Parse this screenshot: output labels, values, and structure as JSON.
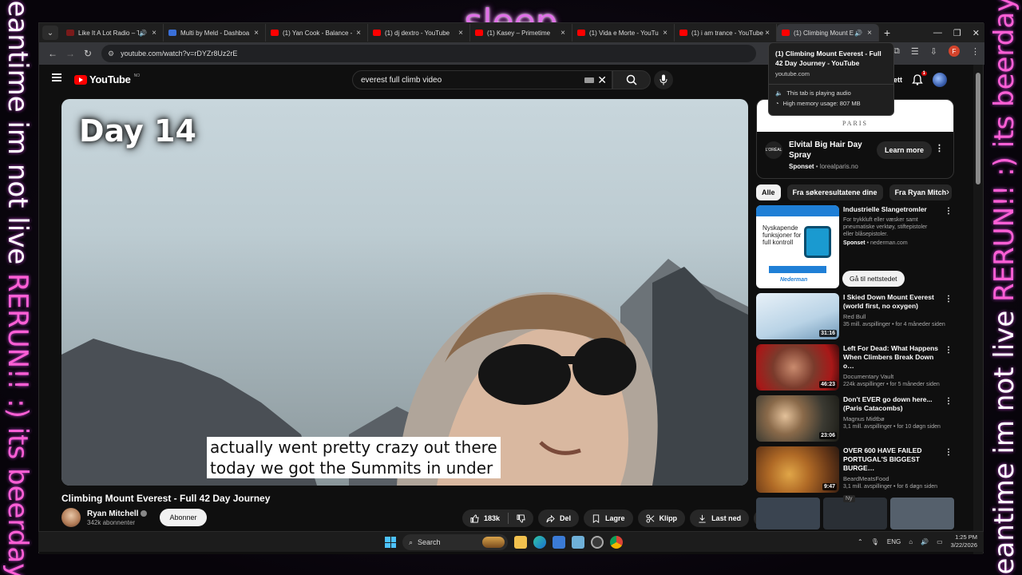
{
  "overlay": {
    "title": "sleep",
    "left_text_a": "meantime im not live ",
    "left_text_b": "RERUN!! :) its beerday!!",
    "right_text_a": "meantime im not live ",
    "right_text_b": "RERUN!! :) its beerday!!"
  },
  "tabs": [
    {
      "label": "Like It A Lot Radio – T",
      "favicon": "dark"
    },
    {
      "label": "Multi by Meld - Dashboa",
      "favicon": "blue"
    },
    {
      "label": "(1) Yan Cook - Balance - Y",
      "favicon": "red"
    },
    {
      "label": "(1) dj dextro - YouTube",
      "favicon": "red"
    },
    {
      "label": "(1) Kasey – Primetime",
      "favicon": "red"
    },
    {
      "label": "(1) Vida e Morte - YouTu",
      "favicon": "red"
    },
    {
      "label": "(1) i am trance - YouTube",
      "favicon": "red"
    },
    {
      "label": "(1) Climbing Mount E",
      "favicon": "red"
    }
  ],
  "address": {
    "url": "youtube.com/watch?v=rDYZr8Uz2rE"
  },
  "tooltip": {
    "title": "(1) Climbing Mount Everest - Full 42 Day Journey - YouTube",
    "url": "youtube.com",
    "audio": "This tab is playing audio",
    "memory": "High memory usage: 807 MB"
  },
  "youtube": {
    "logo": "YouTube",
    "region": "NO",
    "search_value": "everest full climb video",
    "create_label": "ett",
    "notif_count": "1"
  },
  "video": {
    "overlay_text": "Day 14",
    "caption_line1": "actually went pretty crazy out there",
    "caption_line2": "today we got the Summits in under",
    "title": "Climbing Mount Everest - Full 42 Day Journey",
    "channel": "Ryan Mitchell",
    "subscribers": "342k abonnenter",
    "subscribe": "Abonner",
    "likes": "183k",
    "share": "Del",
    "save": "Lagre",
    "clip": "Klipp",
    "download": "Last ned"
  },
  "ad_banner": {
    "brand_top": "PARIS",
    "logo_text": "L'ORÉAL",
    "title": "Elvital Big Hair Day Spray",
    "sponsored": "Sponset",
    "domain": "lorealparis.no",
    "cta": "Learn more"
  },
  "chips": [
    "Alle",
    "Fra søkeresultatene dine",
    "Fra Ryan Mitch"
  ],
  "ad_rec": {
    "thumb_text": "Nyskapende funksjoner for full kontroll",
    "thumb_brand": "Nederman",
    "title": "Industrielle Slangetromler",
    "desc": "For trykkluft eller væsker samt pneumatiske verktøy, stiftepistoler eller blåsepistoler.",
    "sponsored": "Sponset",
    "domain": "nederman.com",
    "cta": "Gå til nettstedet"
  },
  "recs": [
    {
      "title": "I Skied Down Mount Everest (world first, no oxygen)",
      "channel": "Red Bull",
      "meta": "35 mill. avspillinger • for 4 måneder siden",
      "duration": "31:16"
    },
    {
      "title": "Left For Dead: What Happens When Climbers Break Down o…",
      "channel": "Documentary Vault",
      "meta": "224k avspillinger • for 5 måneder siden",
      "duration": "46:23"
    },
    {
      "title": "Don't EVER go down here... (Paris Catacombs)",
      "channel": "Magnus Midtbø",
      "meta": "3,1 mill. avspillinger • for 10 døgn siden",
      "duration": "23:06"
    },
    {
      "title": "OVER 600 HAVE FAILED PORTUGAL'S BIGGEST BURGE…",
      "channel": "BeardMeatsFood",
      "meta": "3,1 mill. avspillinger • for 6 døgn siden",
      "duration": "9:47",
      "badge": "Ny"
    }
  ],
  "taskbar": {
    "search": "Search",
    "lang": "ENG",
    "time": "1:25 PM",
    "date": "3/22/2026"
  }
}
